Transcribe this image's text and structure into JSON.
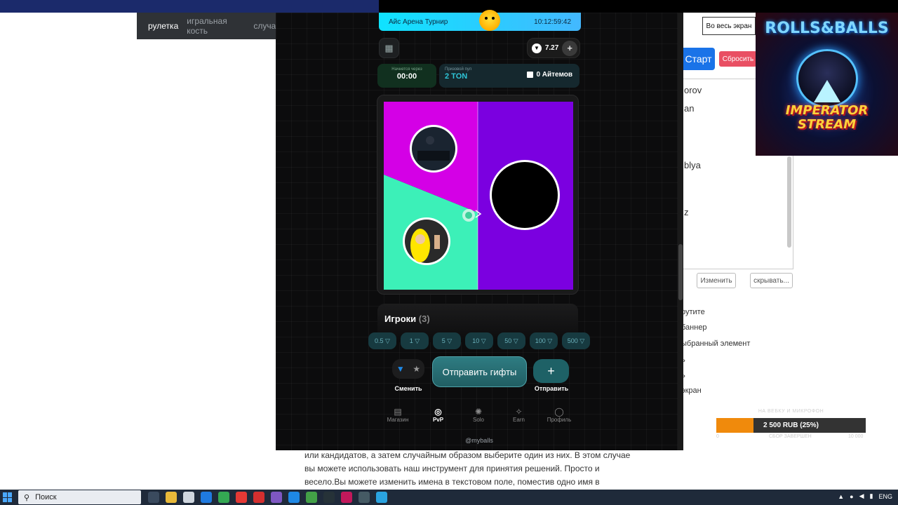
{
  "background_page": {
    "nav_items": [
      "рулетка",
      "игральная кость",
      "случай"
    ],
    "ghost_text": "",
    "fullscreen_label": "Во весь экран",
    "start_label": "Старт",
    "reset_label": "Сбросить",
    "names": [
      "orov",
      "an",
      "blya",
      "z"
    ],
    "edit_label": "Изменить",
    "hide_label": "скрывать...",
    "help_lines": [
      "рутите",
      "баннер",
      "ыбранный элемент",
      "ь",
      "ь",
      "экран"
    ],
    "text": "или кандидатов, а затем случайным образом выберите один из них. В этом случае вы можете использовать наш инструмент для принятия решений. Просто и весело.Вы можете изменить имена в текстовом поле, поместив одно имя в строку.Имена будут нарисованы по кругу. Просто щелкните круговое колесо, оно начнет вращаться в"
  },
  "stream_overlay": {
    "title_top": "ROLLS&BALLS",
    "title_bottom": "IMPERATOR STREAM"
  },
  "donation": {
    "label": "НА ВЕБКУ И МИКРОФОН",
    "text": "2 500 RUB (25%)",
    "progress_percent": 25,
    "min": "0",
    "mid": "СБОР ЗАВЕРШЕН",
    "max": "10 000"
  },
  "app": {
    "banner": {
      "title": "Айс Арена Турнир",
      "time": "10:12:59:42"
    },
    "balance": "7.27",
    "starts_in": {
      "label": "Начнется через",
      "value": "00:00"
    },
    "prize_pool": {
      "label": "Призовой пул",
      "value": "2 TON",
      "items": "0 Айтемов"
    },
    "players": {
      "label": "Игроки",
      "count": "(3)"
    },
    "bets": [
      "0.5",
      "1",
      "5",
      "10",
      "50",
      "100",
      "500"
    ],
    "swap_label": "Сменить",
    "send_gifts_label": "Отправить гифты",
    "send_label": "Отправить",
    "tabs": [
      {
        "label": "Магазин",
        "icon": "shop-icon"
      },
      {
        "label": "PvP",
        "icon": "pvp-icon"
      },
      {
        "label": "Solo",
        "icon": "solo-icon"
      },
      {
        "label": "Earn",
        "icon": "earn-icon"
      },
      {
        "label": "Профиль",
        "icon": "profile-icon"
      }
    ],
    "active_tab": "PvP",
    "handle": "@myballs",
    "arena_colors": {
      "top_left": "#d400e6",
      "bottom_left": "#3cf0b8",
      "right": "#7b00e0"
    }
  },
  "taskbar": {
    "search_placeholder": "Поиск",
    "lang": "ENG"
  }
}
